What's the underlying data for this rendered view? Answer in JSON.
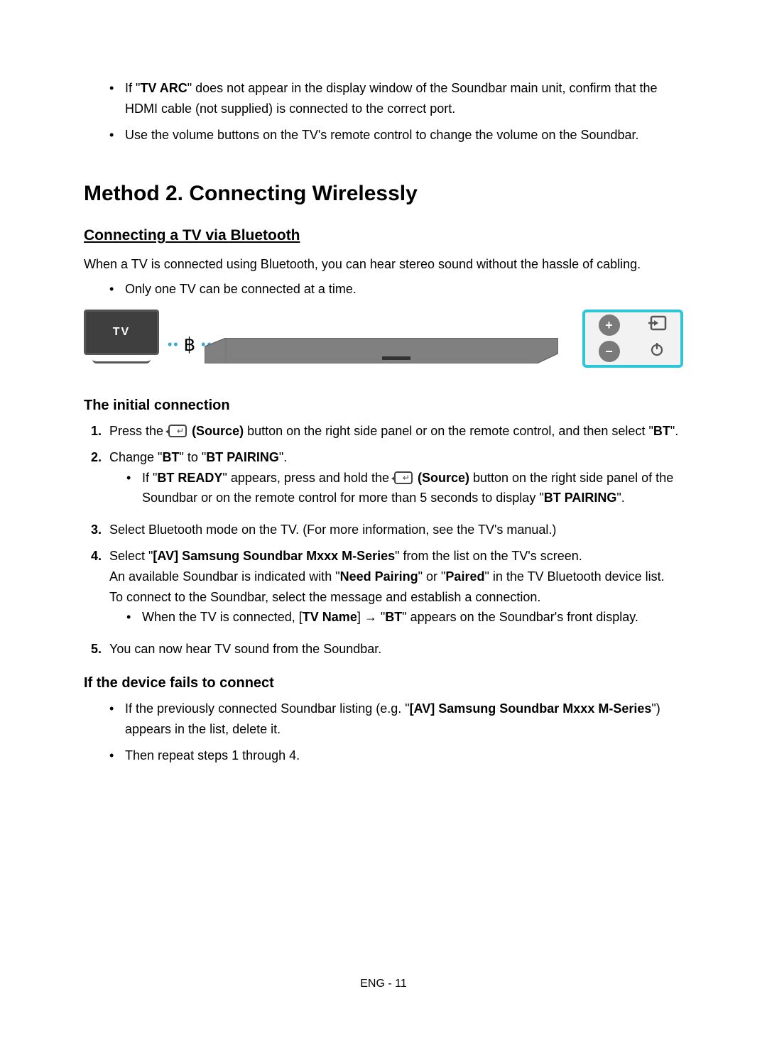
{
  "top_bullets": [
    {
      "parts": [
        "If \"",
        {
          "b": true,
          "t": "TV ARC"
        },
        "\" does not appear in the display window of the Soundbar main unit, confirm that the HDMI cable (not supplied) is connected to the correct port."
      ]
    },
    {
      "parts": [
        "Use the volume buttons on the TV's remote control to change the volume on the Soundbar."
      ]
    }
  ],
  "method_heading": "Method 2. Connecting Wirelessly",
  "sub_heading": "Connecting a TV via Bluetooth",
  "intro": "When a TV is connected using Bluetooth, you can hear stereo sound without the hassle of cabling.",
  "intro_bullet": {
    "parts": [
      "Only one TV can be connected at a time."
    ]
  },
  "figure": {
    "tv_label": "TV",
    "controls": {
      "vol_up": "+",
      "vol_down": "−",
      "source_name": "source-icon",
      "power_name": "power-icon"
    }
  },
  "initial_heading": "The initial connection",
  "steps": [
    {
      "num": "1.",
      "lines": [
        {
          "parts": [
            "Press the ",
            {
              "icon": "source"
            },
            " ",
            {
              "b": true,
              "t": "(Source)"
            },
            " button on the right side panel or on the remote control, and then select \"",
            {
              "b": true,
              "t": "BT"
            },
            "\"."
          ]
        }
      ]
    },
    {
      "num": "2.",
      "lines": [
        {
          "parts": [
            "Change \"",
            {
              "b": true,
              "t": "BT"
            },
            "\" to \"",
            {
              "b": true,
              "t": "BT PAIRING"
            },
            "\"."
          ]
        }
      ],
      "sub_bullets": [
        {
          "parts": [
            "If \"",
            {
              "b": true,
              "t": "BT READY"
            },
            "\" appears, press and hold the ",
            {
              "icon": "source"
            },
            " ",
            {
              "b": true,
              "t": "(Source)"
            },
            " button on the right side panel of the Soundbar or on the remote control for more than 5 seconds to display \"",
            {
              "b": true,
              "t": "BT PAIRING"
            },
            "\"."
          ]
        }
      ]
    },
    {
      "num": "3.",
      "lines": [
        {
          "parts": [
            "Select Bluetooth mode on the TV. (For more information, see the TV's manual.)"
          ]
        }
      ]
    },
    {
      "num": "4.",
      "lines": [
        {
          "parts": [
            "Select \"",
            {
              "b": true,
              "t": "[AV] Samsung Soundbar Mxxx M-Series"
            },
            "\" from the list on the TV's screen."
          ]
        },
        {
          "parts": [
            "An available Soundbar is indicated with \"",
            {
              "b": true,
              "t": "Need Pairing"
            },
            "\" or \"",
            {
              "b": true,
              "t": "Paired"
            },
            "\" in the TV Bluetooth device list."
          ]
        },
        {
          "parts": [
            "To connect to the Soundbar, select the message and establish a connection."
          ]
        }
      ],
      "sub_bullets": [
        {
          "parts": [
            "When the TV is connected, [",
            {
              "b": true,
              "t": "TV Name"
            },
            "] ",
            {
              "arrow": true
            },
            " \"",
            {
              "b": true,
              "t": "BT"
            },
            "\" appears on the Soundbar's front display."
          ]
        }
      ]
    },
    {
      "num": "5.",
      "lines": [
        {
          "parts": [
            "You can now hear TV sound from the Soundbar."
          ]
        }
      ]
    }
  ],
  "fails_heading": "If the device fails to connect",
  "fails_bullets": [
    {
      "parts": [
        "If the previously connected Soundbar listing (e.g. \"",
        {
          "b": true,
          "t": "[AV] Samsung Soundbar Mxxx M-Series"
        },
        "\") appears in the list, delete it."
      ]
    },
    {
      "parts": [
        "Then repeat steps 1 through 4."
      ]
    }
  ],
  "footer": "ENG - 11"
}
